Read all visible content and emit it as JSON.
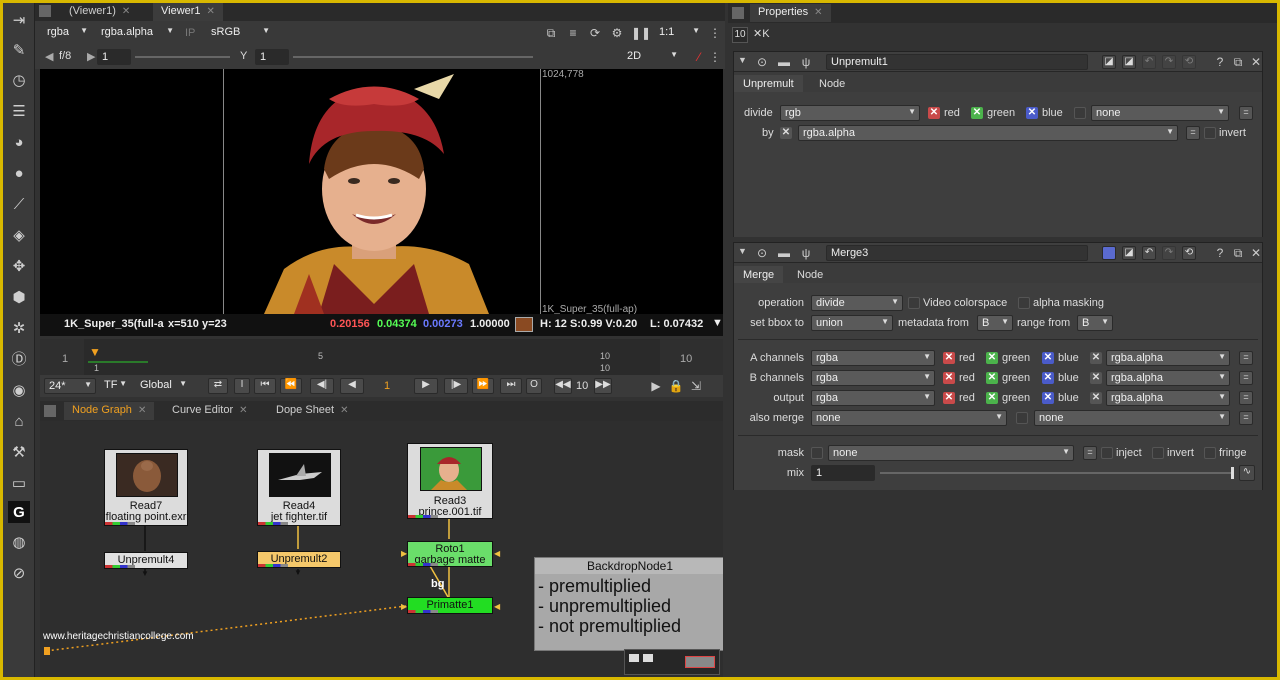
{
  "viewer": {
    "tabs": [
      "(Viewer1)",
      "Viewer1"
    ],
    "channels": "rgba",
    "alpha": "rgba.alpha",
    "ip": "IP",
    "colorspace": "sRGB",
    "zoom": "1:1",
    "fstop": "f/8",
    "gain": "1",
    "y_label": "Y",
    "gamma": "1",
    "view_mode": "2D",
    "format_top": "1024,778",
    "format_bottom": "1K_Super_35(full-ap)",
    "info": {
      "format": "1K_Super_35(full-a",
      "coords": "x=510 y=23",
      "r": "0.20156",
      "g": "0.04374",
      "b": "0.00273",
      "a": "1.00000",
      "swatch": "#8a4a22",
      "hsv": "H: 12 S:0.99 V:0.20",
      "lum": "L: 0.07432"
    }
  },
  "timeline": {
    "start": "1",
    "end": "10",
    "ticks": [
      "1",
      "5",
      "10"
    ],
    "fps": "24*",
    "tf": "TF",
    "scope": "Global",
    "frame": "1",
    "step": "10"
  },
  "node_graph": {
    "tabs": [
      "Node Graph",
      "Curve Editor",
      "Dope Sheet"
    ],
    "nodes": {
      "read7": {
        "name": "Read7",
        "file": "floating point.exr"
      },
      "read4": {
        "name": "Read4",
        "file": "jet fighter.tif"
      },
      "read3": {
        "name": "Read3",
        "file": "prince.001.tif"
      },
      "unpremult4": "Unpremult4",
      "unpremult2": "Unpremult2",
      "roto1": {
        "name": "Roto1",
        "sub": "garbage matte"
      },
      "primatte1": "Primatte1",
      "bg_label": "bg"
    },
    "backdrop": {
      "title": "BackdropNode1",
      "lines": [
        "- premultiplied",
        "- unpremultiplied",
        "- not premultiplied"
      ]
    },
    "watermark": "www.heritagechristiancollege.com"
  },
  "properties": {
    "title": "Properties",
    "max_panels": "10",
    "unpremult": {
      "node_name": "Unpremult1",
      "tabs": [
        "Unpremult",
        "Node"
      ],
      "divide_label": "divide",
      "divide_value": "rgb",
      "red": "red",
      "green": "green",
      "blue": "blue",
      "none": "none",
      "by_label": "by",
      "by_value": "rgba.alpha",
      "invert": "invert"
    },
    "merge": {
      "node_name": "Merge3",
      "tabs": [
        "Merge",
        "Node"
      ],
      "operation_label": "operation",
      "operation_value": "divide",
      "video_colorspace": "Video colorspace",
      "alpha_masking": "alpha masking",
      "bbox_label": "set bbox to",
      "bbox_value": "union",
      "metadata_label": "metadata from",
      "metadata_value": "B",
      "range_label": "range from",
      "range_value": "B",
      "a_channels_label": "A channels",
      "b_channels_label": "B channels",
      "output_label": "output",
      "channels_value": "rgba",
      "alpha_value": "rgba.alpha",
      "red": "red",
      "green": "green",
      "blue": "blue",
      "also_merge_label": "also merge",
      "also_merge_value": "none",
      "also_merge_value2": "none",
      "mask_label": "mask",
      "mask_value": "none",
      "inject": "inject",
      "invert": "invert",
      "fringe": "fringe",
      "mix_label": "mix",
      "mix_value": "1"
    }
  }
}
